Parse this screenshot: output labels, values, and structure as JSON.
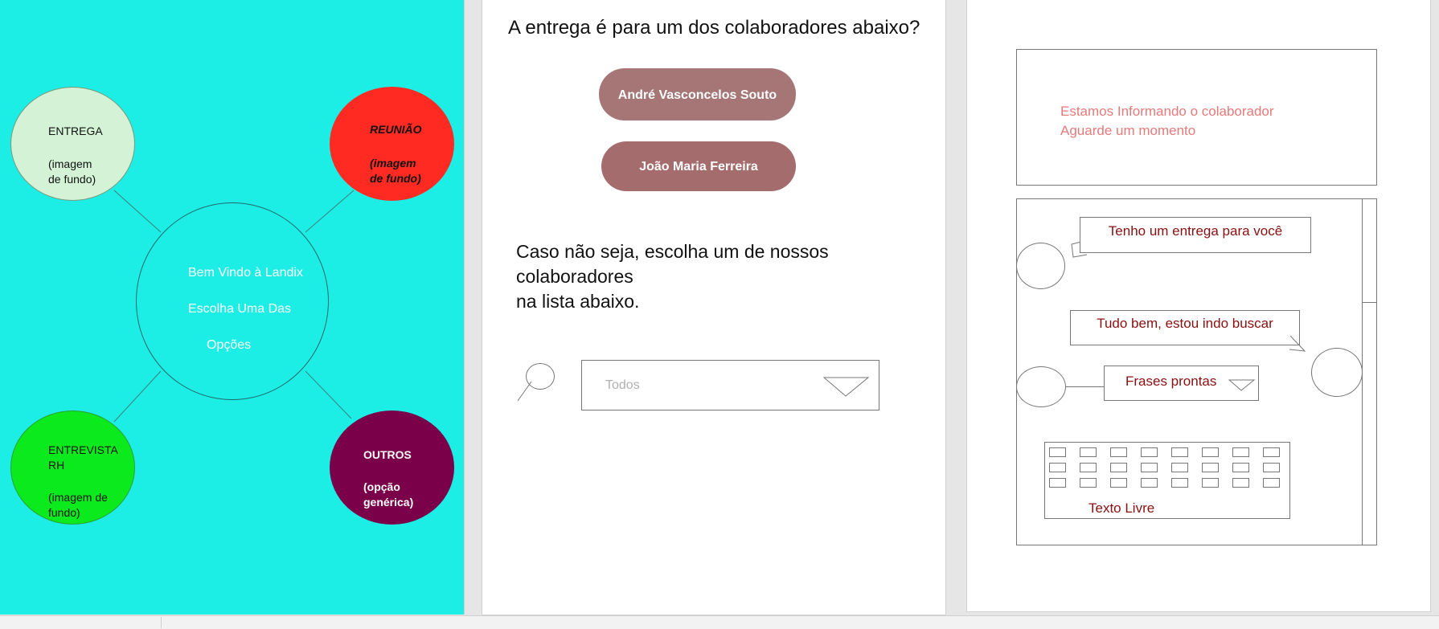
{
  "screen1": {
    "options": {
      "entrega": {
        "title": "ENTREGA",
        "note_1": "(imagem",
        "note_2": "de fundo)",
        "color": "#d4f3d6"
      },
      "reuniao": {
        "title": "REUNIÃO",
        "note_1": "(imagem",
        "note_2": "de fundo)",
        "color": "#ff2a22"
      },
      "entrevista": {
        "title_1": "ENTREVISTA",
        "title_2": "RH",
        "note_1": "(imagem de",
        "note_2": "fundo)",
        "color": "#0bea1c"
      },
      "outros": {
        "title": "OUTROS",
        "note_1": "(opção",
        "note_2": "genérica)",
        "color": "#7a0049"
      }
    },
    "welcome": {
      "line_1": "Bem Vindo à Landix",
      "line_2": "Escolha Uma Das",
      "line_3": "Opções"
    },
    "background": "#1ceee6"
  },
  "screen2": {
    "question": "A entrega é para um dos colaboradores abaixo?",
    "collaborators": [
      "André Vasconcelos Souto",
      "João Maria Ferreira"
    ],
    "fallback_text_1": "Caso não seja, escolha um de nossos colaboradores",
    "fallback_text_2": "na lista abaixo.",
    "search_icon": "search-icon",
    "dropdown": {
      "value": "Todos",
      "icon": "triangle-down-icon"
    }
  },
  "screen3": {
    "status": {
      "line_1": "Estamos Informando o colaborador",
      "line_2": "Aguarde um momento",
      "color": "#e57a7a"
    },
    "messages": [
      "Tenho um entrega para você",
      "Tudo bem, estou indo buscar"
    ],
    "quick_phrases": {
      "label": "Frases prontas",
      "icon": "triangle-down-icon"
    },
    "keyboard_label": "Texto Livre",
    "text_color": "#8a1010"
  }
}
